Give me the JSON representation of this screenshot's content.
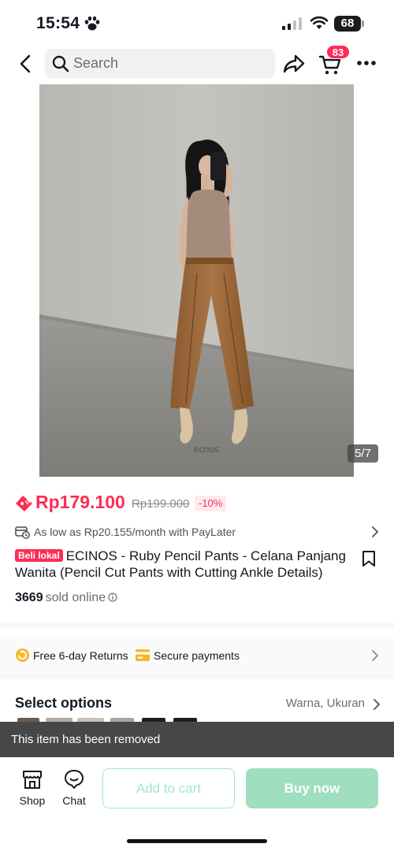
{
  "status_bar": {
    "time": "15:54",
    "battery": "68"
  },
  "header": {
    "search_placeholder": "Search",
    "cart_count": "83"
  },
  "gallery": {
    "counter": "5/7",
    "watermark": "ecnos"
  },
  "price": {
    "current": "Rp179.100",
    "original": "Rp199.000",
    "discount": "-10%"
  },
  "paylater": {
    "text": "As low as Rp20.155/month with PayLater"
  },
  "product": {
    "badge": "Beli lokal",
    "title": "ECINOS - Ruby Pencil Pants - Celana Panjang Wanita (Pencil Cut Pants with Cutting Ankle Details)",
    "sold_count": "3669",
    "sold_label": "sold online"
  },
  "services": {
    "returns": "Free 6-day Returns",
    "secure": "Secure payments"
  },
  "options": {
    "title": "Select options",
    "value": "Warna, Ukuran"
  },
  "toast": {
    "message": "This item has been removed"
  },
  "bottom_bar": {
    "shop_label": "Shop",
    "chat_label": "Chat",
    "add_to_cart": "Add to cart",
    "buy_now": "Buy now"
  },
  "colors": {
    "accent": "#fe2c55",
    "buy_button": "#9fdfbf",
    "toast_bg": "#474747"
  }
}
